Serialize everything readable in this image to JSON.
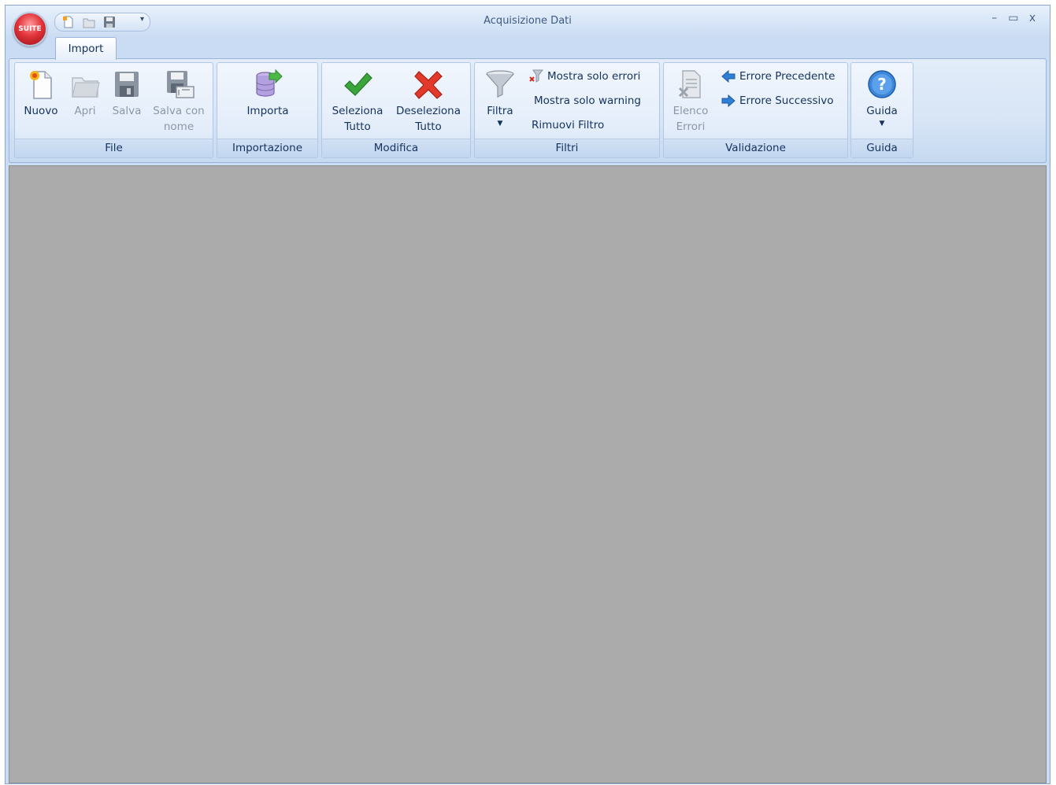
{
  "window": {
    "title": "Acquisizione Dati"
  },
  "app_button": {
    "text": "SUITE"
  },
  "quick_access": {
    "items": [
      "new-icon",
      "open-icon",
      "save-icon"
    ],
    "more_glyph": "▾"
  },
  "window_controls": {
    "minimize": "–",
    "maximize": "▭",
    "close": "x"
  },
  "tabs": [
    {
      "label": "Import"
    }
  ],
  "ribbon": {
    "groups": {
      "file": {
        "label": "File",
        "buttons": {
          "nuovo": "Nuovo",
          "apri": "Apri",
          "salva": "Salva",
          "salva_con_nome": "Salva con nome"
        }
      },
      "importazione": {
        "label": "Importazione",
        "buttons": {
          "importa": "Importa"
        }
      },
      "modifica": {
        "label": "Modifica",
        "buttons": {
          "seleziona_tutto": "Seleziona Tutto",
          "deseleziona_tutto": "Deseleziona Tutto"
        }
      },
      "filtri": {
        "label": "Filtri",
        "buttons": {
          "filtra": "Filtra",
          "mostra_solo_errori": "Mostra solo errori",
          "mostra_solo_warning": "Mostra solo warning",
          "rimuovi_filtro": "Rimuovi Filtro"
        }
      },
      "validazione": {
        "label": "Validazione",
        "buttons": {
          "elenco_errori": "Elenco Errori",
          "errore_precedente": "Errore Precedente",
          "errore_successivo": "Errore Successivo"
        }
      },
      "guida": {
        "label": "Guida",
        "buttons": {
          "guida": "Guida"
        }
      }
    }
  },
  "colors": {
    "accent": "#15325c",
    "disabled_text": "#8a97a8",
    "client_background": "#ababab",
    "check_green": "#3aa53a",
    "cross_red": "#e23a2a"
  }
}
